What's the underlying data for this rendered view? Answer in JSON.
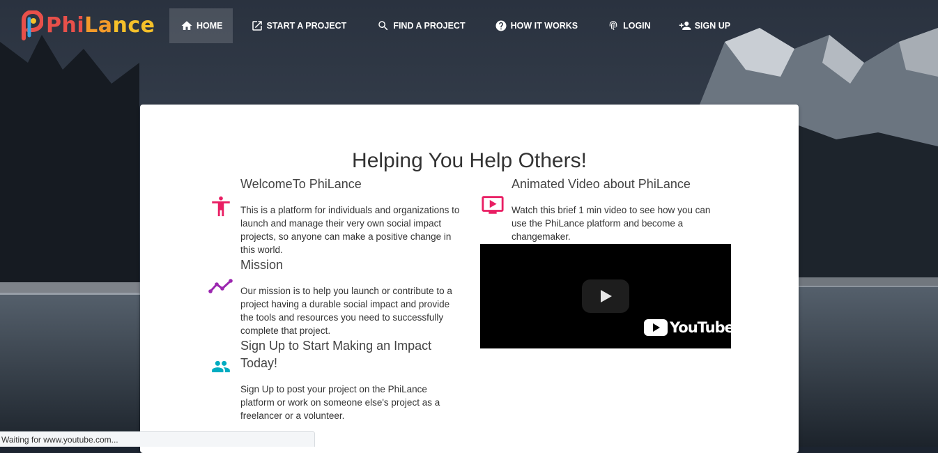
{
  "brand": {
    "name_part1": "Phi",
    "name_part2": "La",
    "name_part3": "nce"
  },
  "nav": [
    {
      "label": "HOME",
      "icon": "home-icon",
      "active": true
    },
    {
      "label": "START A PROJECT",
      "icon": "external-link-icon",
      "active": false
    },
    {
      "label": "FIND A PROJECT",
      "icon": "search-icon",
      "active": false
    },
    {
      "label": "HOW IT WORKS",
      "icon": "help-circle-icon",
      "active": false
    },
    {
      "label": "LOGIN",
      "icon": "fingerprint-icon",
      "active": false
    },
    {
      "label": "SIGN UP",
      "icon": "person-add-icon",
      "active": false
    }
  ],
  "card": {
    "title": "Helping You Help Others!",
    "welcome": {
      "heading": "WelcomeTo PhiLance",
      "text": "This is a platform for individuals and organizations to launch and manage their very own social impact projects, so anyone can make a positive change in this world.",
      "icon": "accessibility-icon",
      "icon_color": "#e91e63"
    },
    "mission": {
      "heading": "Mission",
      "text": "Our mission is to help you launch or contribute to a project having a durable social impact and provide the tools and resources you need to successfully complete that project.",
      "icon": "trending-icon",
      "icon_color": "#9c27b0"
    },
    "signup": {
      "heading": "Sign Up to Start Making an Impact Today!",
      "text": "Sign Up to post your project on the PhiLance platform or work on someone else's project as a freelancer or a volunteer.",
      "icon": "people-icon",
      "icon_color": "#00acc1"
    },
    "video": {
      "heading": "Animated Video about PhiLance",
      "text": "Watch this brief 1 min video to see how you can use the PhiLance platform and become a changemaker.",
      "icon": "ondemand-video-icon",
      "icon_color": "#e91e63",
      "player_logo": "YouTube"
    }
  },
  "status_bar": {
    "text": "Waiting for www.youtube.com..."
  }
}
